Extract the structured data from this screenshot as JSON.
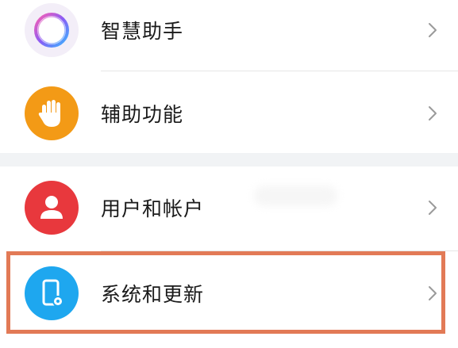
{
  "settings": {
    "items": [
      {
        "label": "智慧助手",
        "icon": "assistant-ring-icon"
      },
      {
        "label": "辅助功能",
        "icon": "hand-icon",
        "color": "#f39a16"
      },
      {
        "label": "用户和帐户",
        "icon": "user-icon",
        "color": "#e8383d"
      },
      {
        "label": "系统和更新",
        "icon": "phone-settings-icon",
        "color": "#1ea7ef"
      }
    ],
    "chevron_icon": "chevron-right-icon",
    "highlight_color": "#e27a56",
    "section_gap_color": "#f1f3f5"
  }
}
